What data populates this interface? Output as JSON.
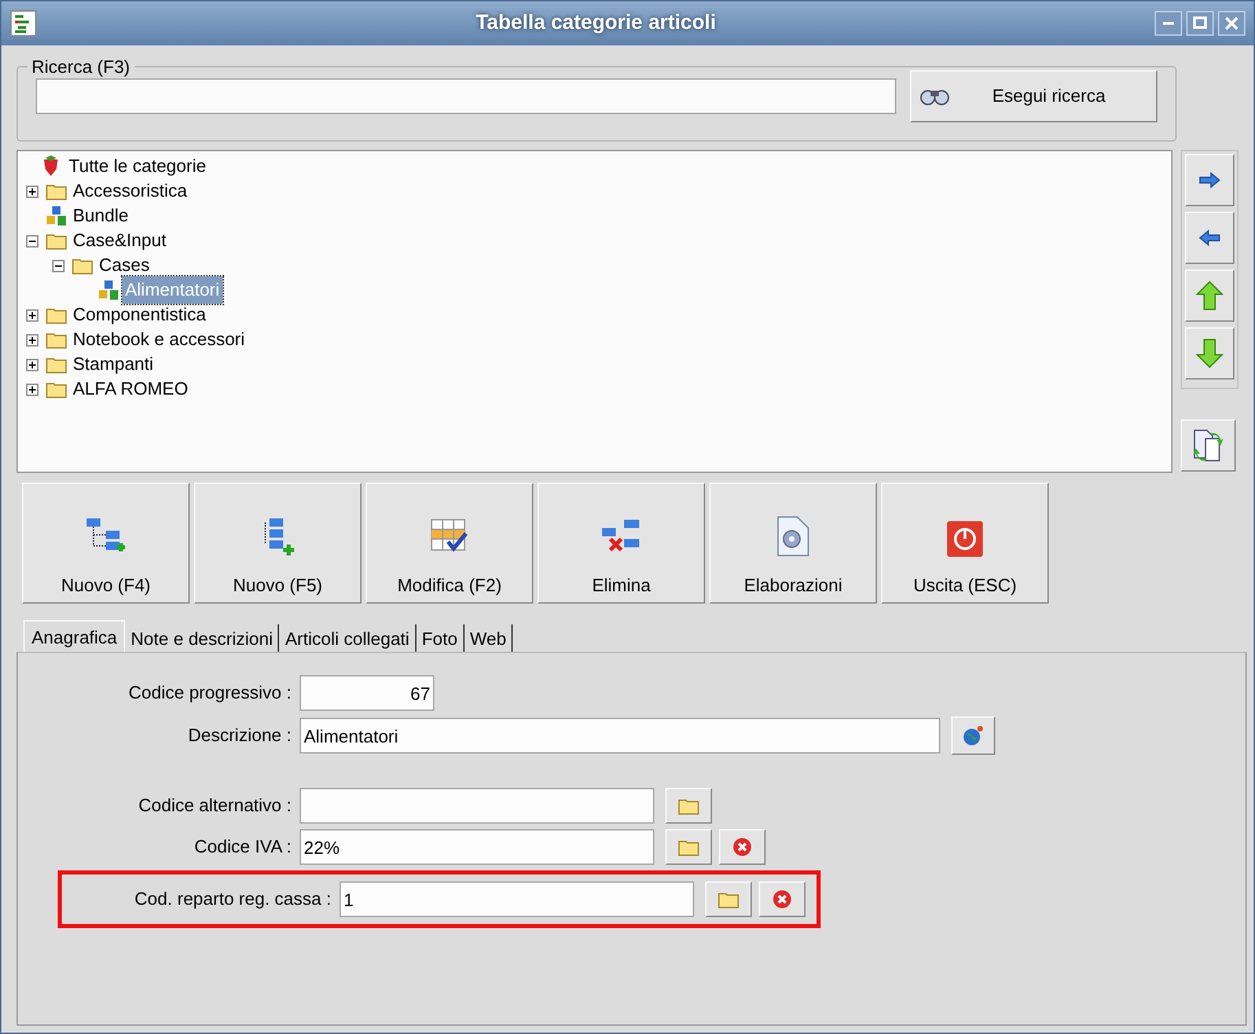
{
  "window": {
    "title": "Tabella categorie articoli"
  },
  "search": {
    "legend": "Ricerca (F3)",
    "button": "Esegui ricerca"
  },
  "tree": [
    {
      "label": "Tutte le categorie",
      "kind": "root",
      "selected": false,
      "children": [
        {
          "label": "Accessoristica",
          "kind": "folder",
          "expanded": false,
          "selected": false
        },
        {
          "label": "Bundle",
          "kind": "bundle",
          "selected": false
        },
        {
          "label": "Case&Input",
          "kind": "folder",
          "expanded": true,
          "selected": false,
          "children": [
            {
              "label": "Cases",
              "kind": "folder",
              "expanded": true,
              "selected": false,
              "children": [
                {
                  "label": "Alimentatori",
                  "kind": "bundle",
                  "selected": true
                }
              ]
            }
          ]
        },
        {
          "label": "Componentistica",
          "kind": "folder",
          "expanded": false,
          "selected": false
        },
        {
          "label": "Notebook e accessori",
          "kind": "folder",
          "expanded": false,
          "selected": false
        },
        {
          "label": "Stampanti",
          "kind": "folder",
          "expanded": false,
          "selected": false
        },
        {
          "label": "ALFA ROMEO",
          "kind": "folder",
          "expanded": false,
          "selected": false
        }
      ]
    }
  ],
  "side_buttons": [
    {
      "kind": "right"
    },
    {
      "kind": "left"
    },
    {
      "kind": "up"
    },
    {
      "kind": "down"
    }
  ],
  "toolbar": [
    {
      "label": "Nuovo (F4)",
      "kind": "new-sibling"
    },
    {
      "label": "Nuovo (F5)",
      "kind": "new-child"
    },
    {
      "label": "Modifica (F2)",
      "kind": "edit"
    },
    {
      "label": "Elimina",
      "kind": "delete"
    },
    {
      "label": "Elaborazioni",
      "kind": "process"
    },
    {
      "label": "Uscita (ESC)",
      "kind": "exit"
    }
  ],
  "tabs": [
    {
      "label": "Anagrafica",
      "selected": true
    },
    {
      "label": "Note e descrizioni",
      "selected": false
    },
    {
      "label": "Articoli collegati",
      "selected": false
    },
    {
      "label": "Foto",
      "selected": false
    },
    {
      "label": "Web",
      "selected": false
    }
  ],
  "fields": [
    {
      "label": "Codice progressivo :",
      "value": "67",
      "kind": "number",
      "highlighted": false
    },
    {
      "label": "Descrizione :",
      "value": "Alimentatori",
      "kind": "wide",
      "highlighted": false,
      "buttons": [
        {
          "kind": "globe"
        }
      ]
    },
    {
      "label": "Codice alternativo :",
      "kind": "lookup",
      "highlighted": false,
      "buttons": [
        {
          "kind": "folder"
        }
      ]
    },
    {
      "label": "Codice IVA :",
      "value": "22%",
      "kind": "lookup",
      "highlighted": false,
      "buttons": [
        {
          "kind": "folder"
        },
        {
          "kind": "clear"
        }
      ]
    },
    {
      "label": "Cod. reparto reg. cassa :",
      "value": "1",
      "kind": "lookup",
      "highlighted": true,
      "buttons": [
        {
          "kind": "folder"
        },
        {
          "kind": "clear"
        }
      ]
    }
  ]
}
